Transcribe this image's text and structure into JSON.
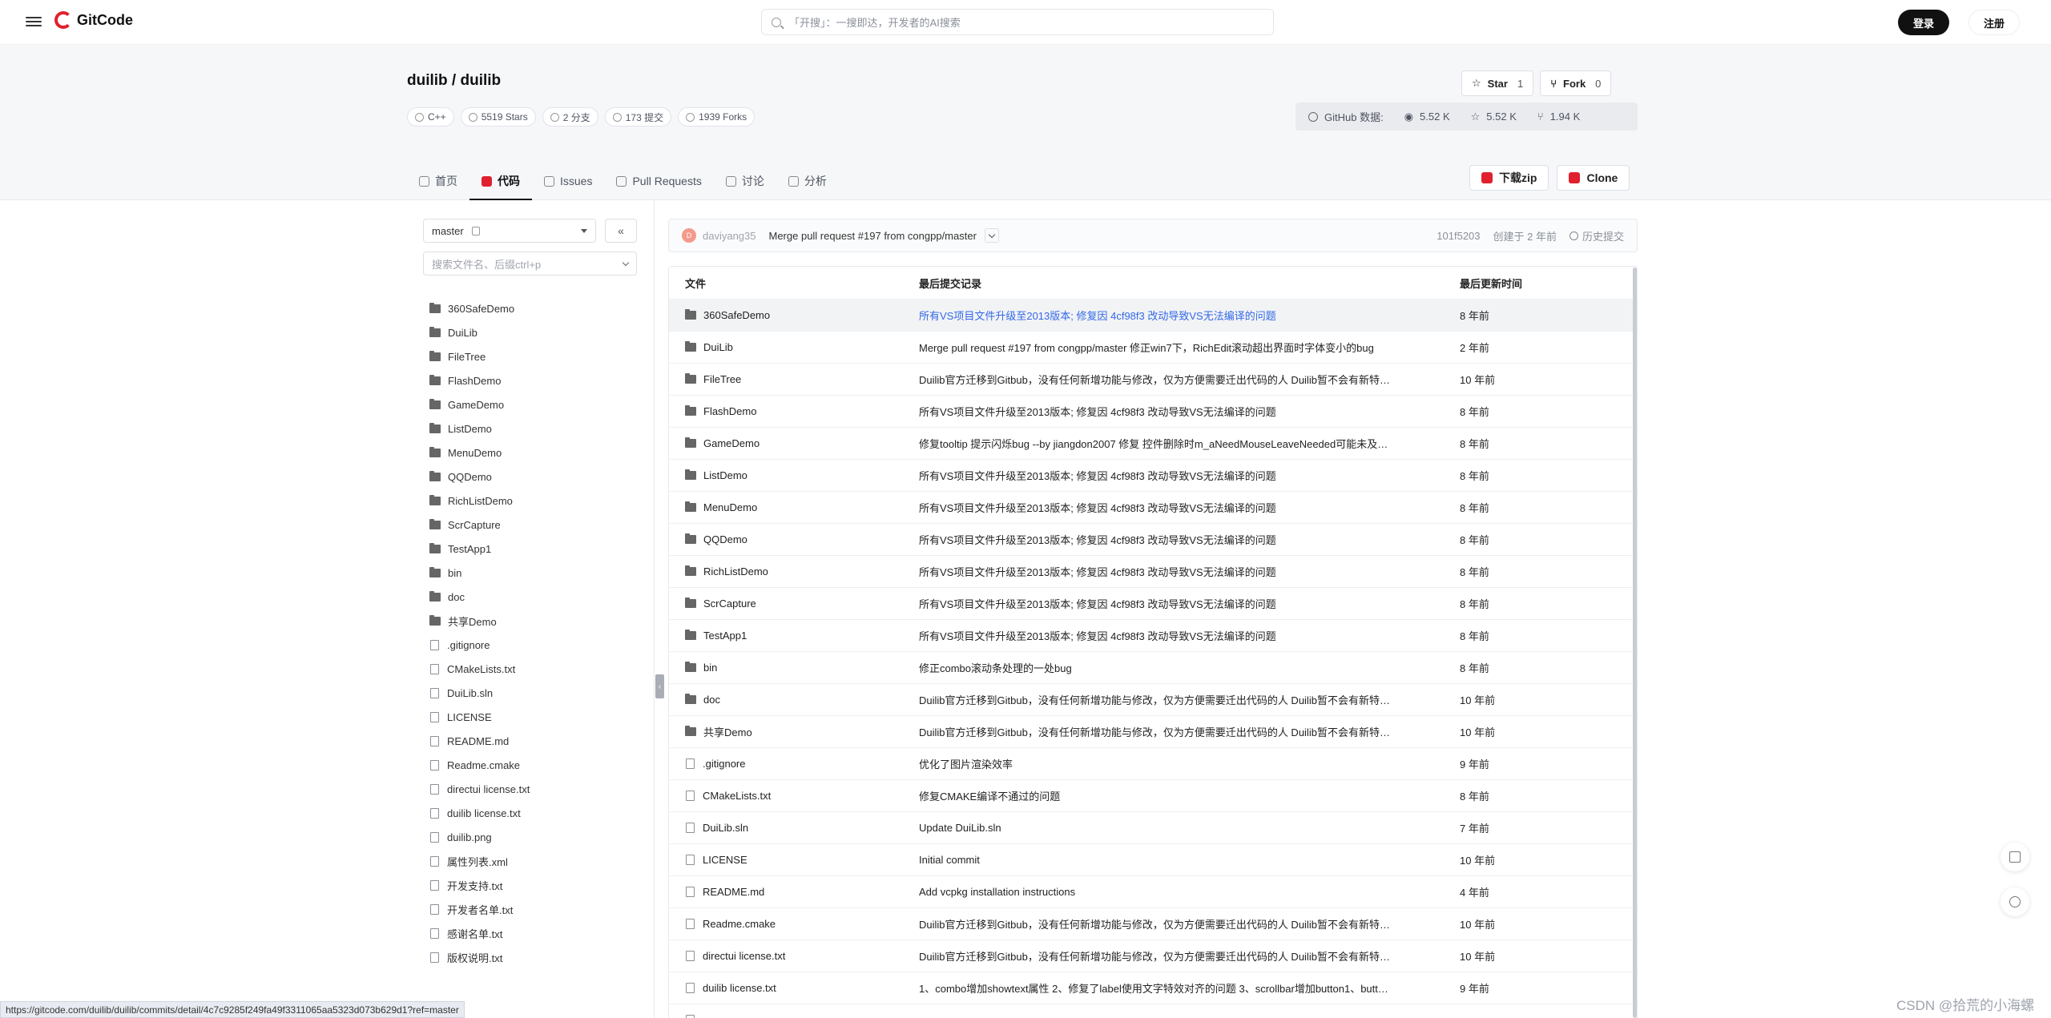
{
  "topnav": {
    "logo": "GitCode",
    "search_placeholder": "「开搜」：一搜即达，开发者的AI搜索",
    "login": "登录",
    "register": "注册"
  },
  "repo": {
    "title": "duilib / duilib",
    "tags": [
      {
        "label": "C++",
        "icon": "code-icon"
      },
      {
        "label": "5519 Stars",
        "icon": "star-icon"
      },
      {
        "label": "2 分支",
        "icon": "branch-icon"
      },
      {
        "label": "173 提交",
        "icon": "commit-icon"
      },
      {
        "label": "1939 Forks",
        "icon": "fork-icon"
      }
    ],
    "star": {
      "label": "Star",
      "count": "1"
    },
    "fork": {
      "label": "Fork",
      "count": "0"
    },
    "github": {
      "label": "GitHub 数据:",
      "watch": "5.52 K",
      "stars": "5.52 K",
      "forks": "1.94 K"
    }
  },
  "tabs": [
    {
      "label": "首页",
      "icon": "home-icon"
    },
    {
      "label": "代码",
      "icon": "code-icon",
      "active": true
    },
    {
      "label": "Issues",
      "icon": "issue-icon"
    },
    {
      "label": "Pull Requests",
      "icon": "pr-icon"
    },
    {
      "label": "讨论",
      "icon": "discussion-icon"
    },
    {
      "label": "分析",
      "icon": "chart-icon"
    }
  ],
  "actions": {
    "download": "下载zip",
    "clone": "Clone"
  },
  "sidebar": {
    "branch": "master",
    "collapse": "«",
    "file_search_placeholder": "搜索文件名、后缀ctrl+p",
    "items": [
      {
        "name": "360SafeDemo",
        "type": "folder"
      },
      {
        "name": "DuiLib",
        "type": "folder"
      },
      {
        "name": "FileTree",
        "type": "folder"
      },
      {
        "name": "FlashDemo",
        "type": "folder"
      },
      {
        "name": "GameDemo",
        "type": "folder"
      },
      {
        "name": "ListDemo",
        "type": "folder"
      },
      {
        "name": "MenuDemo",
        "type": "folder"
      },
      {
        "name": "QQDemo",
        "type": "folder"
      },
      {
        "name": "RichListDemo",
        "type": "folder"
      },
      {
        "name": "ScrCapture",
        "type": "folder"
      },
      {
        "name": "TestApp1",
        "type": "folder"
      },
      {
        "name": "bin",
        "type": "folder"
      },
      {
        "name": "doc",
        "type": "folder"
      },
      {
        "name": "共享Demo",
        "type": "folder"
      },
      {
        "name": ".gitignore",
        "type": "file"
      },
      {
        "name": "CMakeLists.txt",
        "type": "file"
      },
      {
        "name": "DuiLib.sln",
        "type": "file"
      },
      {
        "name": "LICENSE",
        "type": "file"
      },
      {
        "name": "README.md",
        "type": "file"
      },
      {
        "name": "Readme.cmake",
        "type": "file"
      },
      {
        "name": "directui license.txt",
        "type": "file"
      },
      {
        "name": "duilib license.txt",
        "type": "file"
      },
      {
        "name": "duilib.png",
        "type": "file"
      },
      {
        "name": "属性列表.xml",
        "type": "file"
      },
      {
        "name": "开发支持.txt",
        "type": "file"
      },
      {
        "name": "开发者名单.txt",
        "type": "file"
      },
      {
        "name": "感谢名单.txt",
        "type": "file"
      },
      {
        "name": "版权说明.txt",
        "type": "file"
      }
    ]
  },
  "commit": {
    "avatar": "D",
    "author": "daviyang35",
    "message": "Merge pull request #197 from congpp/master",
    "hash": "101f5203",
    "created": "创建于 2 年前",
    "history": "历史提交"
  },
  "table": {
    "headers": [
      "文件",
      "最后提交记录",
      "最后更新时间"
    ],
    "rows": [
      {
        "name": "360SafeDemo",
        "type": "folder",
        "msg": "所有VS项目文件升级至2013版本; 修复因 4cf98f3 改动导致VS无法编译的问题",
        "time": "8 年前"
      },
      {
        "name": "DuiLib",
        "type": "folder",
        "msg": "Merge pull request #197 from congpp/master 修正win7下，RichEdit滚动超出界面时字体变小的bug",
        "time": "2 年前"
      },
      {
        "name": "FileTree",
        "type": "folder",
        "msg": "Duilib官方迁移到Gitbub，没有任何新增功能与修改，仅为方便需要迁出代码的人 Duilib暂不会有新特…",
        "time": "10 年前"
      },
      {
        "name": "FlashDemo",
        "type": "folder",
        "msg": "所有VS项目文件升级至2013版本; 修复因 4cf98f3 改动导致VS无法编译的问题",
        "time": "8 年前"
      },
      {
        "name": "GameDemo",
        "type": "folder",
        "msg": "修复tooltip 提示闪烁bug --by jiangdon2007 修复 控件删除时m_aNeedMouseLeaveNeeded可能未及…",
        "time": "8 年前"
      },
      {
        "name": "ListDemo",
        "type": "folder",
        "msg": "所有VS项目文件升级至2013版本; 修复因 4cf98f3 改动导致VS无法编译的问题",
        "time": "8 年前"
      },
      {
        "name": "MenuDemo",
        "type": "folder",
        "msg": "所有VS项目文件升级至2013版本; 修复因 4cf98f3 改动导致VS无法编译的问题",
        "time": "8 年前"
      },
      {
        "name": "QQDemo",
        "type": "folder",
        "msg": "所有VS项目文件升级至2013版本; 修复因 4cf98f3 改动导致VS无法编译的问题",
        "time": "8 年前"
      },
      {
        "name": "RichListDemo",
        "type": "folder",
        "msg": "所有VS项目文件升级至2013版本; 修复因 4cf98f3 改动导致VS无法编译的问题",
        "time": "8 年前"
      },
      {
        "name": "ScrCapture",
        "type": "folder",
        "msg": "所有VS项目文件升级至2013版本; 修复因 4cf98f3 改动导致VS无法编译的问题",
        "time": "8 年前"
      },
      {
        "name": "TestApp1",
        "type": "folder",
        "msg": "所有VS项目文件升级至2013版本; 修复因 4cf98f3 改动导致VS无法编译的问题",
        "time": "8 年前"
      },
      {
        "name": "bin",
        "type": "folder",
        "msg": "修正combo滚动条处理的一处bug",
        "time": "8 年前"
      },
      {
        "name": "doc",
        "type": "folder",
        "msg": "Duilib官方迁移到Gitbub，没有任何新增功能与修改，仅为方便需要迁出代码的人 Duilib暂不会有新特…",
        "time": "10 年前"
      },
      {
        "name": "共享Demo",
        "type": "folder",
        "msg": "Duilib官方迁移到Gitbub，没有任何新增功能与修改，仅为方便需要迁出代码的人 Duilib暂不会有新特…",
        "time": "10 年前"
      },
      {
        "name": ".gitignore",
        "type": "file",
        "msg": "优化了图片渲染效率",
        "time": "9 年前"
      },
      {
        "name": "CMakeLists.txt",
        "type": "file",
        "msg": "修复CMAKE编译不通过的问题",
        "time": "8 年前"
      },
      {
        "name": "DuiLib.sln",
        "type": "file",
        "msg": "Update DuiLib.sln",
        "time": "7 年前"
      },
      {
        "name": "LICENSE",
        "type": "file",
        "msg": "Initial commit",
        "time": "10 年前"
      },
      {
        "name": "README.md",
        "type": "file",
        "msg": "Add vcpkg installation instructions",
        "time": "4 年前"
      },
      {
        "name": "Readme.cmake",
        "type": "file",
        "msg": "Duilib官方迁移到Gitbub，没有任何新增功能与修改，仅为方便需要迁出代码的人 Duilib暂不会有新特…",
        "time": "10 年前"
      },
      {
        "name": "directui license.txt",
        "type": "file",
        "msg": "Duilib官方迁移到Gitbub，没有任何新增功能与修改，仅为方便需要迁出代码的人 Duilib暂不会有新特…",
        "time": "10 年前"
      },
      {
        "name": "duilib license.txt",
        "type": "file",
        "msg": "1、combo增加showtext属性 2、修复了label使用文字特效对齐的问题 3、scrollbar增加button1、butt…",
        "time": "9 年前"
      },
      {
        "name": "",
        "type": "file",
        "msg": "",
        "time": ""
      }
    ]
  },
  "statusbar": "https://gitcode.com/duilib/duilib/commits/detail/4c7c9285f249fa49f3311065aa5323d073b629d1?ref=master",
  "watermark": "CSDN @拾荒的小海螺"
}
